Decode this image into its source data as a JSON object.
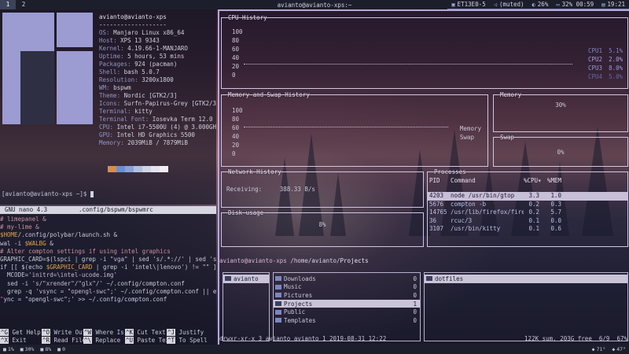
{
  "topbar": {
    "workspaces": [
      "1",
      "2"
    ],
    "window_title": "avianto@avianto-xps:~",
    "modules": [
      {
        "icon": "network-icon",
        "glyph": "▣",
        "text": "ET13E0-5"
      },
      {
        "icon": "volume-icon",
        "glyph": "◁",
        "text": "(muted)"
      },
      {
        "icon": "brightness-icon",
        "glyph": "◐",
        "text": "26%"
      },
      {
        "icon": "battery-icon",
        "glyph": "▭",
        "text": "32% 00:59"
      },
      {
        "icon": "clock-icon",
        "glyph": "▤",
        "text": "19:21"
      }
    ]
  },
  "neofetch": {
    "user_host": "avianto@avianto-xps",
    "separator": "-------------------",
    "rows": [
      {
        "k": "OS",
        "v": "Manjaro Linux x86_64"
      },
      {
        "k": "Host",
        "v": "XPS 13 9343"
      },
      {
        "k": "Kernel",
        "v": "4.19.66-1-MANJARO"
      },
      {
        "k": "Uptime",
        "v": "5 hours, 53 mins"
      },
      {
        "k": "Packages",
        "v": "924 (pacman)"
      },
      {
        "k": "Shell",
        "v": "bash 5.0.7"
      },
      {
        "k": "Resolution",
        "v": "3200x1800"
      },
      {
        "k": "WM",
        "v": "bspwm"
      },
      {
        "k": "Theme",
        "v": "Nordic [GTK2/3]"
      },
      {
        "k": "Icons",
        "v": "Surfn-Papirus-Grey [GTK2/3]"
      },
      {
        "k": "Terminal",
        "v": "kitty"
      },
      {
        "k": "Terminal Font",
        "v": "Iosevka Term 12.0"
      },
      {
        "k": "CPU",
        "v": "Intel i7-5500U (4) @ 3.000GHz"
      },
      {
        "k": "GPU",
        "v": "Intel HD Graphics 5500"
      },
      {
        "k": "Memory",
        "v": "2039MiB / 7879MiB"
      }
    ],
    "swatch_colors": [
      "#d98c4e",
      "#6a8ed4",
      "#8aa2d8",
      "#b2c0e0",
      "#d0d4e6",
      "#e6e2ee",
      "#f2eef4"
    ],
    "prompt": "[avianto@avianto-xps ~]$ "
  },
  "nano": {
    "version": "GNU nano 4.3",
    "file": ".config/bspwm/bspwmrc",
    "lines": [
      [
        {
          "t": "# limepanel &",
          "c": "cm"
        }
      ],
      [
        {
          "t": "# my-lime &",
          "c": "cm"
        }
      ],
      [
        {
          "t": "$HOME",
          "c": "vr"
        },
        {
          "t": "/.config/polybar/launch.sh &",
          "c": ""
        }
      ],
      [
        {
          "t": "wal -i ",
          "c": ""
        },
        {
          "t": "$WALBG",
          "c": "vr"
        },
        {
          "t": " &",
          "c": ""
        }
      ],
      [
        {
          "t": "# Alter compton settings if using intel graphics",
          "c": "cm"
        }
      ],
      [
        {
          "t": "GRAPHIC_CARD=$(lspci | grep -i ",
          "c": ""
        },
        {
          "t": "\"vga\"",
          "c": "st"
        },
        {
          "t": " | sed 's/.*://' | sed 's/(.*//' | sed 's/^[ \\t]*//')",
          "c": ""
        }
      ],
      [
        {
          "t": "if [[ $(echo ",
          "c": ""
        },
        {
          "t": "$GRAPHIC_CARD",
          "c": "vr"
        },
        {
          "t": " | grep -i 'intel\\|lenovo') != \"\" ]]; then",
          "c": ""
        }
      ],
      [
        {
          "t": "  MCODE=",
          "c": ""
        },
        {
          "t": "'initrd=\\intel-ucode.img'",
          "c": "st"
        }
      ],
      [
        {
          "t": "  sed -i ",
          "c": ""
        },
        {
          "t": "'s/\"xrender\"/\"glx\"/'",
          "c": "st"
        },
        {
          "t": " ~/.config/compton.conf",
          "c": ""
        }
      ],
      [
        {
          "t": "  grep -q ",
          "c": ""
        },
        {
          "t": "'vsync = \"opengl-swc\";'",
          "c": "st"
        },
        {
          "t": " ~/.config/compton.conf || echo 'vsync'",
          "c": ""
        }
      ],
      [
        {
          "t": "\"",
          "c": "rd"
        },
        {
          "t": "ync = \"opengl-swc\";' >> ~/.config/compton.conf",
          "c": ""
        }
      ]
    ],
    "shortcuts": [
      [
        {
          "k": "^G",
          "l": "Get Help"
        },
        {
          "k": "^O",
          "l": "Write Out"
        },
        {
          "k": "^W",
          "l": "Where Is"
        },
        {
          "k": "^K",
          "l": "Cut Text"
        },
        {
          "k": "^J",
          "l": "Justify"
        }
      ],
      [
        {
          "k": "^X",
          "l": "Exit"
        },
        {
          "k": "^R",
          "l": "Read File"
        },
        {
          "k": "^\\",
          "l": "Replace"
        },
        {
          "k": "^U",
          "l": "Paste Text"
        },
        {
          "k": "^T",
          "l": "To Spell"
        }
      ]
    ]
  },
  "gtop": {
    "cpu": {
      "title": "CPU History",
      "axis": [
        "100",
        "80",
        "60",
        "40",
        "20",
        "0"
      ],
      "legend": [
        {
          "name": "CPU1",
          "value": "5.1%"
        },
        {
          "name": "CPU2",
          "value": "2.0%"
        },
        {
          "name": "CPU3",
          "value": "8.0%"
        },
        {
          "name": "CPU4",
          "value": "5.0%"
        }
      ]
    },
    "memswap": {
      "title": "Memory and Swap History",
      "axis": [
        "100",
        "80",
        "60",
        "40",
        "20",
        "0"
      ],
      "legend": [
        "Memory",
        "Swap"
      ]
    },
    "memory": {
      "title": "Memory",
      "value": "30%"
    },
    "swap": {
      "title": "Swap",
      "value": "0%"
    },
    "network": {
      "title": "Network History",
      "label": "Receiving:",
      "value": "388.33",
      "unit": "B/s"
    },
    "disk": {
      "title": "Disk usage",
      "value": "8%"
    },
    "processes": {
      "title": "Processes",
      "headers": [
        "PID",
        "Command",
        "%CPU▾",
        "%MEM"
      ],
      "rows": [
        {
          "pid": "4203",
          "cmd": "node /usr/bin/gtop",
          "cpu": "3.3",
          "mem": "1.0",
          "sel": true
        },
        {
          "pid": "5676",
          "cmd": "compton -b",
          "cpu": "0.2",
          "mem": "0.3",
          "sel": false
        },
        {
          "pid": "14765",
          "cmd": "/usr/lib/firefox/firefox",
          "cpu": "0.2",
          "mem": "5.7",
          "sel": false
        },
        {
          "pid": "36",
          "cmd": "rcuc/3",
          "cpu": "0.1",
          "mem": "0.0",
          "sel": false
        },
        {
          "pid": "3107",
          "cmd": "/usr/bin/kitty",
          "cpu": "0.1",
          "mem": "0.6",
          "sel": false
        }
      ]
    }
  },
  "ranger": {
    "user_host": "avianto@avianto-xps",
    "path": "/home/avianto/",
    "dir": "Projects",
    "col1": [
      {
        "name": "avianto",
        "sel": true
      }
    ],
    "col2": [
      {
        "name": "Downloads",
        "count": "0"
      },
      {
        "name": "Music",
        "count": "0"
      },
      {
        "name": "Pictures",
        "count": "0"
      },
      {
        "name": "Projects",
        "count": "1",
        "sel": true
      },
      {
        "name": "Public",
        "count": "0"
      },
      {
        "name": "Templates",
        "count": "0"
      }
    ],
    "col3": [
      {
        "name": "dotfiles",
        "sel": true
      }
    ],
    "status_left": "drwxr-xr-x 3 avianto avianto 1 2019-08-31 12:22",
    "status_right": "122K sum, 203G free  6/9  67%"
  },
  "bottombar": {
    "left": [
      {
        "icon": "cpu-icon",
        "text": "1%"
      },
      {
        "icon": "ram-icon",
        "text": "30%"
      },
      {
        "icon": "disk-icon",
        "text": "8%"
      },
      {
        "icon": "net-icon",
        "text": "0"
      }
    ],
    "right": [
      {
        "icon": "temp-icon",
        "text": "71°"
      },
      {
        "icon": "fan-icon",
        "text": "47°"
      }
    ]
  }
}
